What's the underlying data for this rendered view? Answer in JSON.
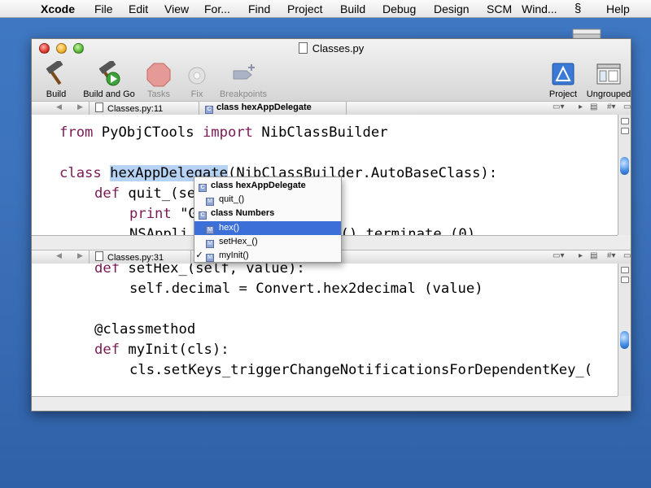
{
  "menubar": {
    "app": "Xcode",
    "items": [
      "File",
      "Edit",
      "View",
      "For...",
      "Find",
      "Project",
      "Build",
      "Debug",
      "Design",
      "SCM",
      "Wind...",
      "Help"
    ]
  },
  "window": {
    "title": "Classes.py",
    "toolbar": {
      "build": "Build",
      "build_and_go": "Build and Go",
      "tasks": "Tasks",
      "fix": "Fix",
      "breakpoints": "Breakpoints",
      "project": "Project",
      "ungrouped": "Ungrouped"
    },
    "top_nav": {
      "file": "Classes.py:11",
      "symbol": "class hexAppDelegate",
      "symbol_badge": "C"
    },
    "bottom_nav": {
      "file": "Classes.py:31"
    },
    "top_code": {
      "l1_kw": "from",
      "l1_a": " PyObjCTools ",
      "l1_kw2": "import",
      "l1_b": " NibClassBuilder",
      "l3_kw": "class",
      "l3_sel": "hexAppDelegate",
      "l3_rest": "(NibClassBuilder.AutoBaseClass):",
      "l4_kw": "def",
      "l4_rest": " quit_(se",
      "l5_kw": "print",
      "l5_rest": " \"G",
      "l6_a": "NSAppli",
      "l6_b": "cation().terminate_(0)"
    },
    "bottom_code": {
      "l1_kw": "def",
      "l1_rest": " setHex_(self, value):",
      "l2": "self.decimal = Convert.hex2decimal (value)",
      "l4": "@classmethod",
      "l5_kw": "def",
      "l5_rest": " myInit(cls):",
      "l6": "cls.setKeys_triggerChangeNotificationsForDependentKey_("
    }
  },
  "popup": {
    "items": [
      {
        "label": "class hexAppDelegate",
        "badge": "C",
        "bold": true
      },
      {
        "label": "quit_()",
        "badge": "M",
        "bold": false
      },
      {
        "label": "class Numbers",
        "badge": "C",
        "bold": true
      },
      {
        "label": "hex()",
        "badge": "M",
        "bold": false
      },
      {
        "label": "setHex_()",
        "badge": "M",
        "bold": false
      },
      {
        "label": "myInit()",
        "badge": "M",
        "bold": false,
        "check": "✓"
      }
    ],
    "highlighted_index": 3
  },
  "colors": {
    "keyword": "#7b1a52",
    "selection": "#b7d3f3",
    "menu_highlight": "#3d6fd9",
    "desktop": "#3c72bb"
  }
}
